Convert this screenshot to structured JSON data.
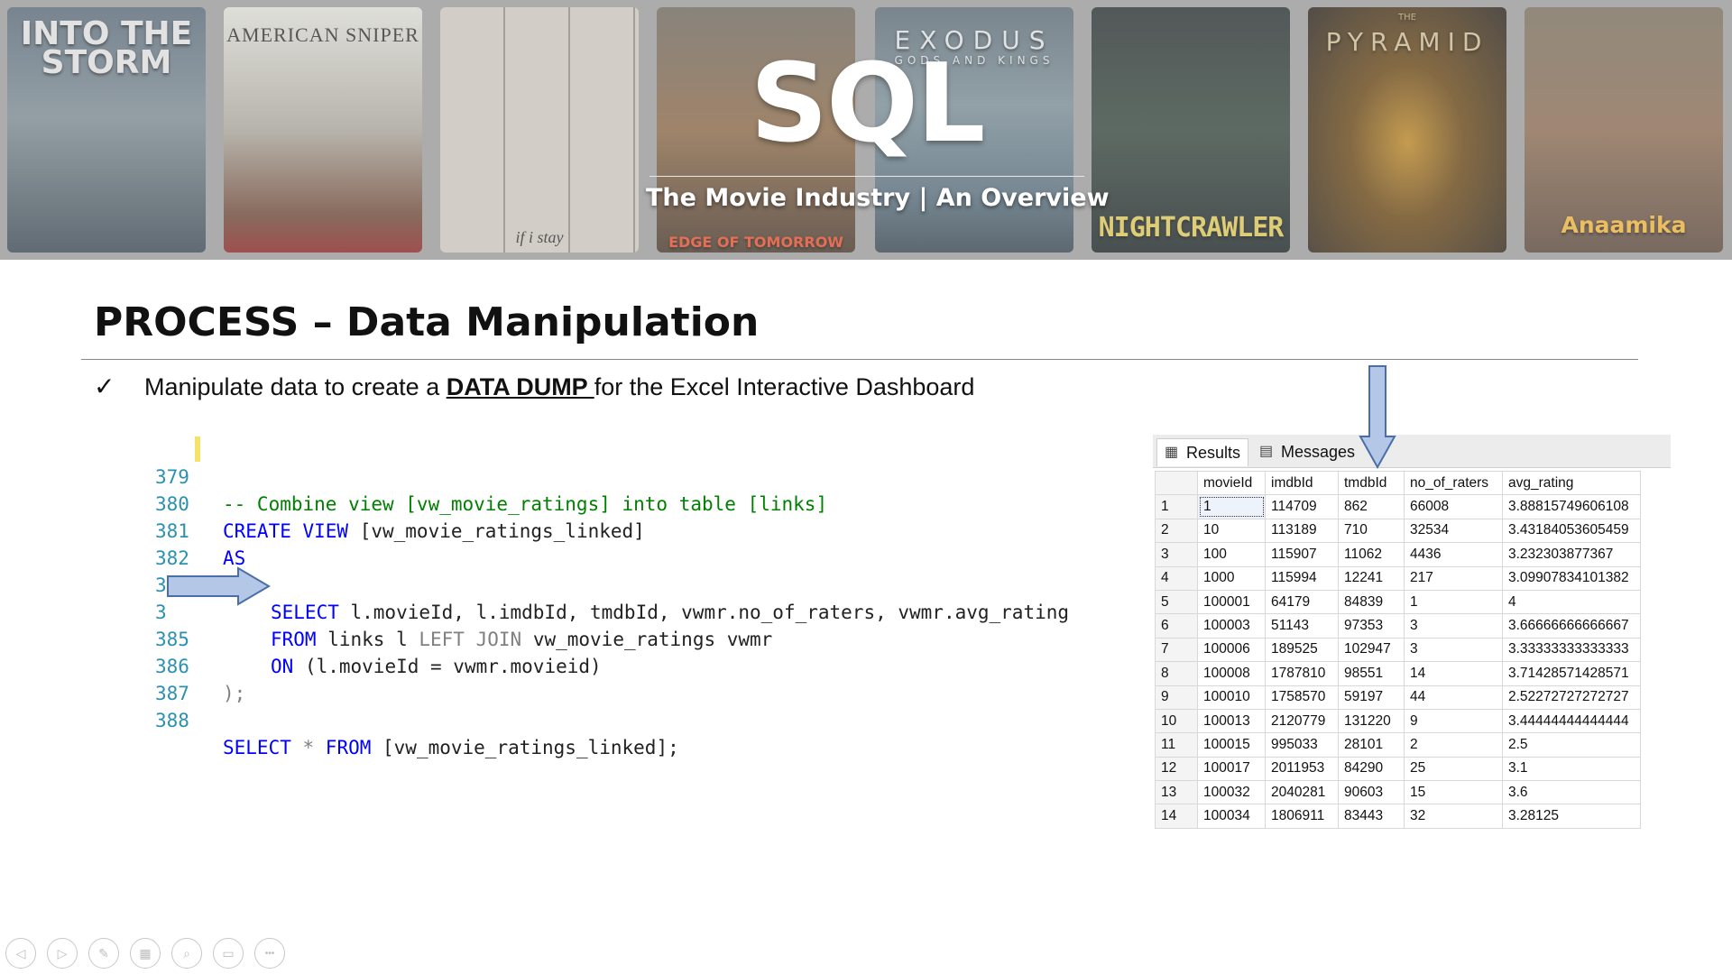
{
  "banner": {
    "posters": [
      {
        "title": "INTO THE\nSTORM"
      },
      {
        "title": "AMERICAN SNIPER"
      },
      {
        "title": "if i stay"
      },
      {
        "title": "EDGE OF TOMORROW"
      },
      {
        "title": "EXODUS",
        "subtitle": "GODS AND KINGS"
      },
      {
        "title": "NIGHTCRAWLER"
      },
      {
        "title": "PYRAMID",
        "subtitle": "THE"
      },
      {
        "title": "Anaamika"
      }
    ],
    "logo": "SQL",
    "subtitle": "The Movie Industry | An Overview"
  },
  "slide": {
    "heading": "PROCESS – Data Manipulation",
    "bullet_mark": "✓",
    "bullet_pre": "Manipulate data to create a ",
    "bullet_em": "DATA DUMP ",
    "bullet_post": "for the Excel Interactive Dashboard"
  },
  "code": {
    "line_numbers": [
      "379",
      "380",
      "381",
      "382",
      "383",
      "3",
      "385",
      "386",
      "387",
      "388"
    ],
    "l379": "-- Combine view [vw_movie_ratings] into table [links]",
    "l380_kw1": "CREATE",
    "l380_kw2": " VIEW",
    "l380_rest": " [vw_movie_ratings_linked]",
    "l381": "AS",
    "l382": "(",
    "l383_kw": "SELECT",
    "l383_rest": " l.movieId, l.imdbId, tmdbId, vwmr.no_of_raters, vwmr.avg_rating",
    "l384_kw": "FROM",
    "l384_mid": " links l ",
    "l384_join": "LEFT JOIN",
    "l384_rest": " vw_movie_ratings vwmr",
    "l385_kw": "ON",
    "l385_rest": " (l.movieId = vwmr.movieid)",
    "l386": ");",
    "l388_kw1": "SELECT",
    "l388_star": " * ",
    "l388_kw2": "FROM",
    "l388_rest": " [vw_movie_ratings_linked];"
  },
  "results": {
    "tab_results": "Results",
    "tab_messages": "Messages",
    "columns": [
      "movieId",
      "imdbId",
      "tmdbId",
      "no_of_raters",
      "avg_rating"
    ],
    "rows": [
      [
        "1",
        "1",
        "114709",
        "862",
        "66008",
        "3.88815749606108"
      ],
      [
        "2",
        "10",
        "113189",
        "710",
        "32534",
        "3.43184053605459"
      ],
      [
        "3",
        "100",
        "115907",
        "11062",
        "4436",
        "3.232303877367"
      ],
      [
        "4",
        "1000",
        "115994",
        "12241",
        "217",
        "3.09907834101382"
      ],
      [
        "5",
        "100001",
        "64179",
        "84839",
        "1",
        "4"
      ],
      [
        "6",
        "100003",
        "51143",
        "97353",
        "3",
        "3.66666666666667"
      ],
      [
        "7",
        "100006",
        "189525",
        "102947",
        "3",
        "3.33333333333333"
      ],
      [
        "8",
        "100008",
        "1787810",
        "98551",
        "14",
        "3.71428571428571"
      ],
      [
        "9",
        "100010",
        "1758570",
        "59197",
        "44",
        "2.52272727272727"
      ],
      [
        "10",
        "100013",
        "2120779",
        "131220",
        "9",
        "3.44444444444444"
      ],
      [
        "11",
        "100015",
        "995033",
        "28101",
        "2",
        "2.5"
      ],
      [
        "12",
        "100017",
        "2011953",
        "84290",
        "25",
        "3.1"
      ],
      [
        "13",
        "100032",
        "2040281",
        "90603",
        "15",
        "3.6"
      ],
      [
        "14",
        "100034",
        "1806911",
        "83443",
        "32",
        "3.28125"
      ]
    ]
  },
  "toolbar": {
    "icons": [
      "prev-icon",
      "next-icon",
      "pen-icon",
      "slides-icon",
      "zoom-icon",
      "subtitles-icon",
      "more-icon"
    ],
    "glyphs": [
      "◁",
      "▷",
      "✎",
      "▦",
      "⌕",
      "▭",
      "•••"
    ]
  },
  "colors": {
    "keyword": "#0000ff",
    "comment": "#008000",
    "line_number": "#2b91af",
    "arrow_fill": "#b4c7e7",
    "arrow_stroke": "#4a6fa8"
  }
}
